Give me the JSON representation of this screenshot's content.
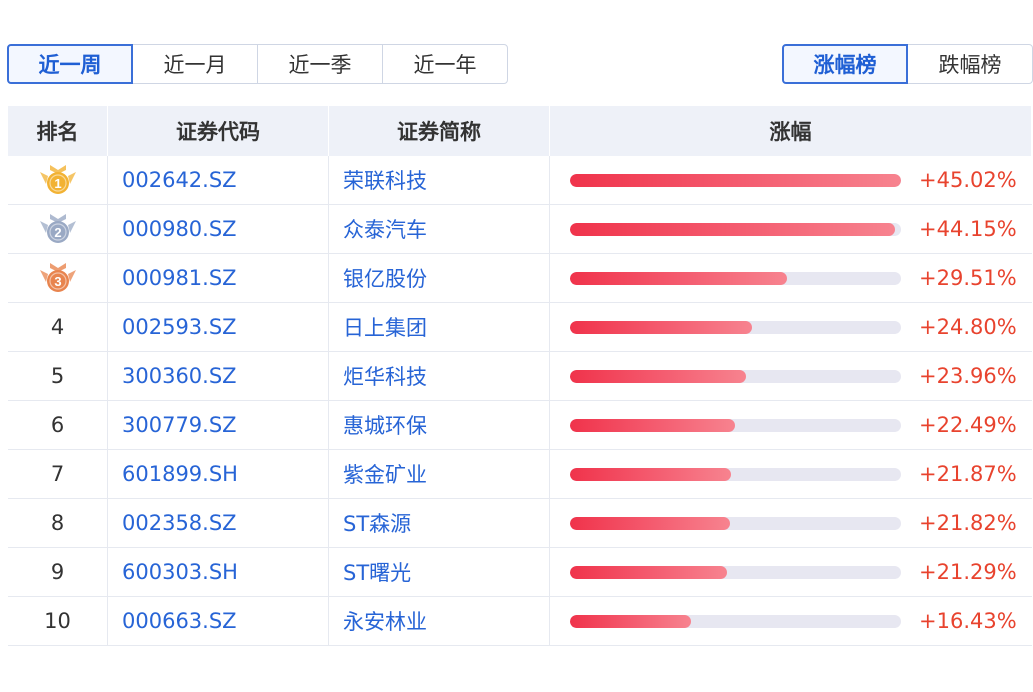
{
  "period_tabs": [
    {
      "label": "近一周",
      "active": true
    },
    {
      "label": "近一月",
      "active": false
    },
    {
      "label": "近一季",
      "active": false
    },
    {
      "label": "近一年",
      "active": false
    }
  ],
  "rank_tabs": [
    {
      "label": "涨幅榜",
      "active": true
    },
    {
      "label": "跌幅榜",
      "active": false
    }
  ],
  "table": {
    "headers": {
      "rank": "排名",
      "code": "证券代码",
      "name": "证券简称",
      "gain": "涨幅"
    },
    "max_gain": 45.02,
    "rows": [
      {
        "rank": "1",
        "code": "002642.SZ",
        "name": "荣联科技",
        "gain": 45.02,
        "gain_text": "+45.02%",
        "medal": "gold"
      },
      {
        "rank": "2",
        "code": "000980.SZ",
        "name": "众泰汽车",
        "gain": 44.15,
        "gain_text": "+44.15%",
        "medal": "silver"
      },
      {
        "rank": "3",
        "code": "000981.SZ",
        "name": "银亿股份",
        "gain": 29.51,
        "gain_text": "+29.51%",
        "medal": "bronze"
      },
      {
        "rank": "4",
        "code": "002593.SZ",
        "name": "日上集团",
        "gain": 24.8,
        "gain_text": "+24.80%"
      },
      {
        "rank": "5",
        "code": "300360.SZ",
        "name": "炬华科技",
        "gain": 23.96,
        "gain_text": "+23.96%"
      },
      {
        "rank": "6",
        "code": "300779.SZ",
        "name": "惠城环保",
        "gain": 22.49,
        "gain_text": "+22.49%"
      },
      {
        "rank": "7",
        "code": "601899.SH",
        "name": "紫金矿业",
        "gain": 21.87,
        "gain_text": "+21.87%"
      },
      {
        "rank": "8",
        "code": "002358.SZ",
        "name": "ST森源",
        "gain": 21.82,
        "gain_text": "+21.82%"
      },
      {
        "rank": "9",
        "code": "600303.SH",
        "name": "ST曙光",
        "gain": 21.29,
        "gain_text": "+21.29%"
      },
      {
        "rank": "10",
        "code": "000663.SZ",
        "name": "永安林业",
        "gain": 16.43,
        "gain_text": "+16.43%"
      }
    ]
  },
  "colors": {
    "accent": "#1f5fd4",
    "link": "#2764d6",
    "positive": "#e8432e",
    "bar": "#f0334b",
    "gold": "#f2b233",
    "silver": "#9aa9c4",
    "bronze": "#e8844e"
  }
}
